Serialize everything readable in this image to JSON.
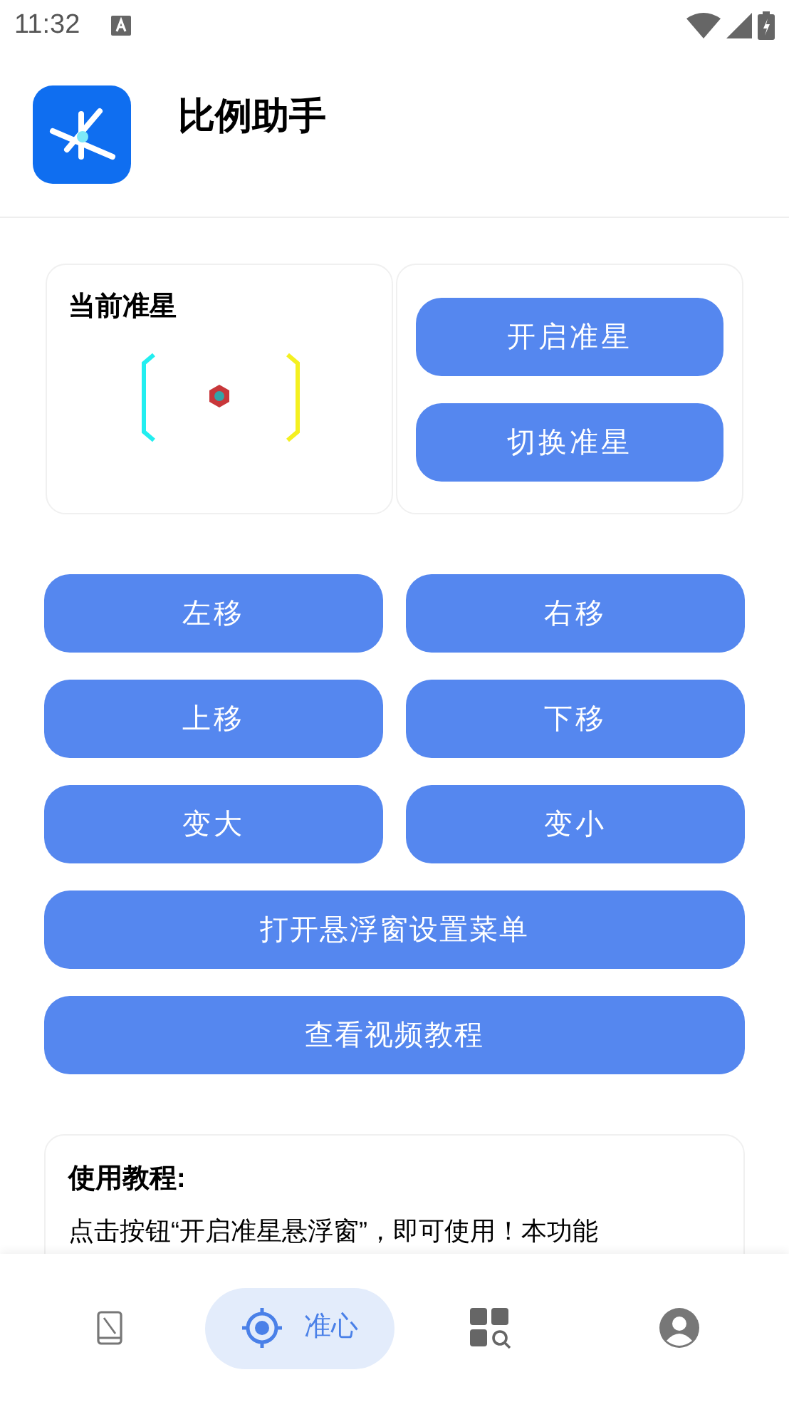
{
  "status_bar": {
    "time": "11:32"
  },
  "app": {
    "title": "比例助手"
  },
  "crosshair_card": {
    "title": "当前准星"
  },
  "side_buttons": [
    "开启准星",
    "切换准星"
  ],
  "grid_buttons": [
    "左移",
    "右移",
    "上移",
    "下移",
    "变大",
    "变小"
  ],
  "wide_buttons": [
    "打开悬浮窗设置菜单",
    "查看视频教程"
  ],
  "tutorial": {
    "title": "使用教程:",
    "text": "点击按钮“开启准星悬浮窗”，即可使用！本功能"
  },
  "nav": [
    {
      "kind": "phone",
      "selected": false
    },
    {
      "kind": "crosshair",
      "label": "准心",
      "selected": true
    },
    {
      "kind": "apps",
      "selected": false
    },
    {
      "kind": "profile",
      "selected": false
    }
  ]
}
